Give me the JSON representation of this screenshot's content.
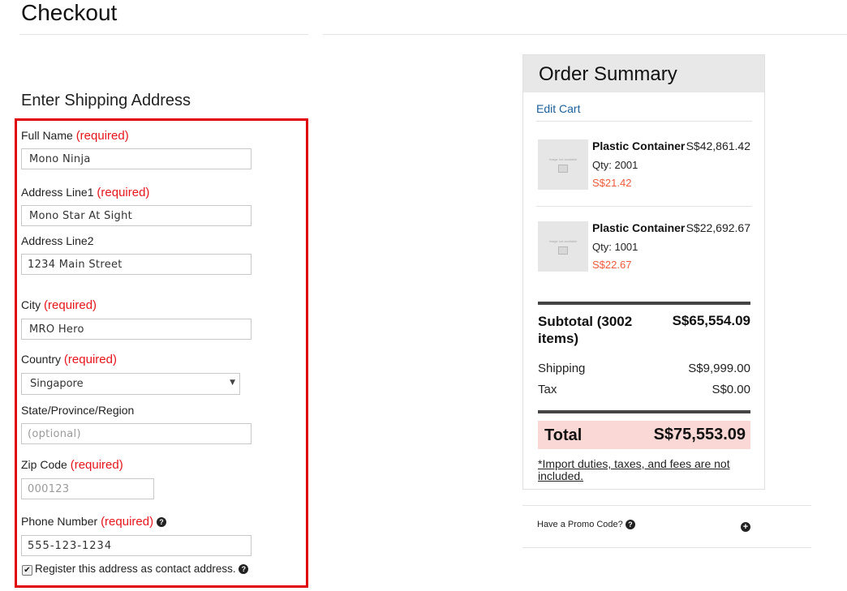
{
  "page": {
    "title": "Checkout"
  },
  "shipping": {
    "title": "Enter Shipping Address",
    "required_text": "(required)",
    "full_name": {
      "label": "Full Name",
      "value": "Mono Ninja"
    },
    "address1": {
      "label": "Address Line1",
      "value": "Mono Star At Sight"
    },
    "address2": {
      "label": "Address Line2",
      "value": "1234 Main Street"
    },
    "city": {
      "label": "City",
      "value": "MRO Hero"
    },
    "country": {
      "label": "Country",
      "value": "Singapore"
    },
    "state": {
      "label": "State/Province/Region",
      "placeholder": "(optional)"
    },
    "zip": {
      "label": "Zip Code",
      "placeholder": "000123"
    },
    "phone": {
      "label": "Phone Number",
      "value": "555-123-1234"
    },
    "register": {
      "label": "Register this address as contact address.",
      "checked": true
    }
  },
  "summary": {
    "title": "Order Summary",
    "edit_cart": "Edit Cart",
    "image_placeholder": "image not available",
    "items": [
      {
        "name": "Plastic Container",
        "price": "S$42,861.42",
        "qty_label": "Qty:",
        "qty": "2001",
        "unit_price": "S$21.42"
      },
      {
        "name": "Plastic Container",
        "price": "S$22,692.67",
        "qty_label": "Qty:",
        "qty": "1001",
        "unit_price": "S$22.67"
      }
    ],
    "subtotal_label": "Subtotal (3002 items)",
    "subtotal_value": "S$65,554.09",
    "shipping_label": "Shipping",
    "shipping_value": "S$9,999.00",
    "tax_label": "Tax",
    "tax_value": "S$0.00",
    "total_label": "Total",
    "total_value": "S$75,553.09",
    "duties_note": "*Import duties, taxes, and fees are not included."
  },
  "promo": {
    "label": "Have a Promo Code?"
  },
  "colors": {
    "required": "#e8141c",
    "highlight_border": "#e0000a",
    "link": "#1a5e9a",
    "unit_price": "#f05a3c",
    "total_bg": "#fad8d5"
  },
  "icons": {
    "help": "question-circle-icon",
    "expand": "plus-circle-icon",
    "checkbox": "checkmark-icon",
    "caret": "caret-down-icon"
  }
}
